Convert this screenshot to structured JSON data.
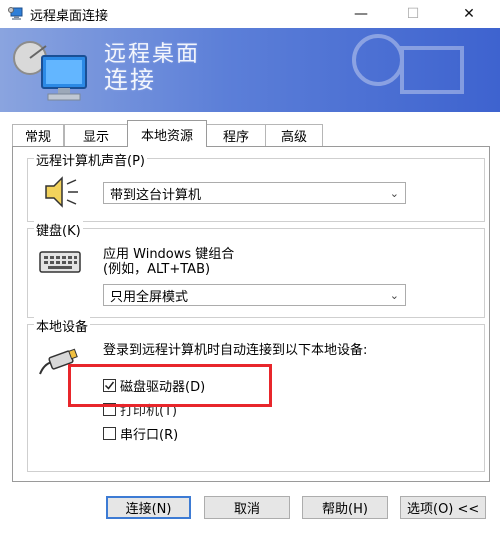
{
  "window": {
    "title": "远程桌面连接",
    "controls": {
      "minimize": "—",
      "maximize": "☐",
      "close": "✕"
    }
  },
  "banner": {
    "line1": "远程桌面",
    "line2": "连接"
  },
  "tabs": [
    {
      "label": "常规"
    },
    {
      "label": "显示"
    },
    {
      "label": "本地资源",
      "selected": true
    },
    {
      "label": "程序"
    },
    {
      "label": "高级"
    }
  ],
  "audio": {
    "label": "远程计算机声音(P)",
    "selected": "带到这台计算机"
  },
  "keyboard": {
    "label": "键盘(K)",
    "desc1": "应用 Windows 键组合",
    "desc2": "(例如，ALT+TAB)",
    "selected": "只用全屏模式"
  },
  "devices": {
    "label": "本地设备",
    "desc": "登录到远程计算机时自动连接到以下本地设备:",
    "items": [
      {
        "label": "磁盘驱动器(D)",
        "checked": true
      },
      {
        "label": "打印机(T)",
        "checked": false
      },
      {
        "label": "串行口(R)",
        "checked": false
      }
    ]
  },
  "buttons": {
    "connect": "连接(N)",
    "cancel": "取消",
    "help": "帮助(H)",
    "options": "选项(O) <<"
  },
  "colors": {
    "highlight": "#e8262b",
    "banner": "#4a6fd4",
    "focus": "#3d7bd4"
  }
}
